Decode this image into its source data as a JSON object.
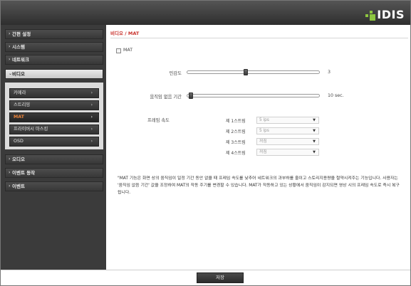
{
  "brand": {
    "logo_text": "IDIS",
    "logo_color": "#8dc63f"
  },
  "sidebar": {
    "items": [
      {
        "label": "간편 설정"
      },
      {
        "label": "시스템"
      },
      {
        "label": "네트워크"
      },
      {
        "label": "비디오",
        "expanded": true
      },
      {
        "label": "오디오"
      },
      {
        "label": "이벤트 동작"
      },
      {
        "label": "이벤트"
      }
    ],
    "video_submenu": [
      {
        "label": "카메라"
      },
      {
        "label": "스트리밍"
      },
      {
        "label": "MAT",
        "active": true
      },
      {
        "label": "프라이버시 마스킹"
      },
      {
        "label": "OSD"
      }
    ],
    "chevron_glyph": "›"
  },
  "main": {
    "breadcrumb_section": "비디오",
    "breadcrumb_sep": " / ",
    "breadcrumb_page": "MAT",
    "mat_checkbox_label": "MAT",
    "mat_checked": false,
    "sensitivity": {
      "label": "민감도",
      "value": "3",
      "level_fraction": 0.44
    },
    "inactivity": {
      "label": "움직임 없음 기간",
      "value": "10 sec.",
      "level_fraction": 0.0
    },
    "frame_rate": {
      "label": "프레임 속도",
      "streams": [
        {
          "label": "제 1스트림",
          "value": "5 ips"
        },
        {
          "label": "제 2스트림",
          "value": "5 ips"
        },
        {
          "label": "제 3스트림",
          "value": "꺼짐"
        },
        {
          "label": "제 4스트림",
          "value": "꺼짐"
        }
      ]
    },
    "note": "\"MAT 기능은 화면 상의 움직임이 일정 기간 동안 없을 때 프레임 속도를 낮추어 네트워크의 과부하를 줄이고 스토리지용량을 절약시켜주는 기능입니다. 사용자는 '움직임 없음 기간' 값을 조정하여 MAT의 작동 주기를 변경할 수 있습니다. MAT가 작동하고 있는 상황에서 움직임이 감지되면 영상 시의 프레임 속도로 즉시 복구됩니다."
  },
  "footer": {
    "save_label": "저장"
  },
  "colors": {
    "accent_red": "#c9322c",
    "active_orange": "#e8823a",
    "sidebar_bg": "#3b3b3b"
  }
}
